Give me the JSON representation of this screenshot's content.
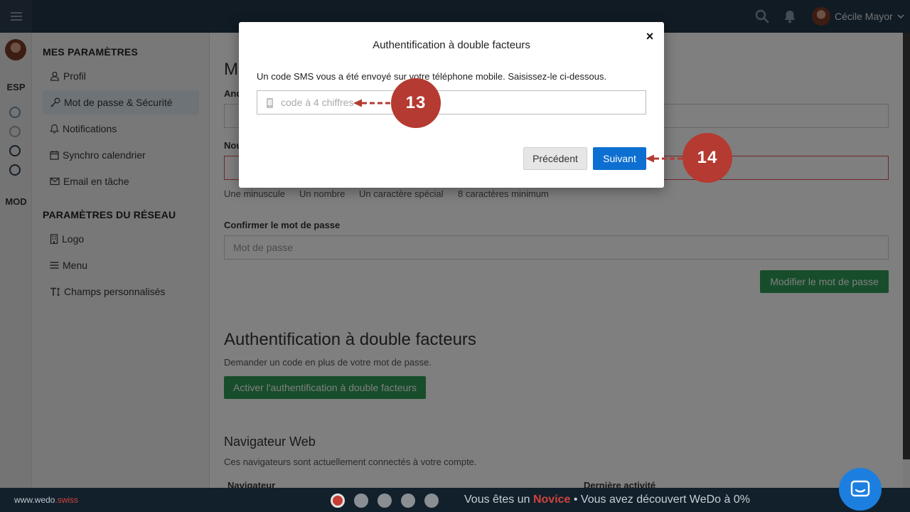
{
  "topbar": {
    "user_name": "Cécile Mayor"
  },
  "rail": {
    "section1": "ESP",
    "section2": "MOD"
  },
  "sidebar": {
    "heading1": "MES PARAMÈTRES",
    "items1": [
      {
        "label": "Profil"
      },
      {
        "label": "Mot de passe & Sécurité"
      },
      {
        "label": "Notifications"
      },
      {
        "label": "Synchro calendrier"
      },
      {
        "label": "Email en tâche"
      }
    ],
    "heading2": "PARAMÈTRES DU RÉSEAU",
    "items2": [
      {
        "label": "Logo"
      },
      {
        "label": "Menu"
      },
      {
        "label": "Champs personnalisés"
      }
    ]
  },
  "main": {
    "title_partial": "M",
    "old_pw_label": "And",
    "new_pw_label": "Nou",
    "rules": [
      "Une minuscule",
      "Un nombre",
      "Un caractère spécial",
      "8 caractères minimum"
    ],
    "confirm_label": "Confirmer le mot de passe",
    "confirm_placeholder": "Mot de passe",
    "change_pw_button": "Modifier le mot de passe",
    "twofa_title": "Authentification à double facteurs",
    "twofa_desc": "Demander un code en plus de votre mot de passe.",
    "twofa_button": "Activer l'authentification à double facteurs",
    "browsers_title": "Navigateur Web",
    "browsers_desc": "Ces navigateurs sont actuellement connectés à votre compte.",
    "col_browser": "Navigateur",
    "col_last_activity": "Dernière activité"
  },
  "modal": {
    "title": "Authentification à double facteurs",
    "close_label": "×",
    "message": "Un code SMS vous a été envoyé sur votre téléphone mobile. Saisissez-le ci-dessous.",
    "code_placeholder": "code à 4 chiffres",
    "code_value": "",
    "prev_button": "Précédent",
    "next_button": "Suivant"
  },
  "annotations": {
    "step_a": "13",
    "step_b": "14"
  },
  "bottombar": {
    "brand_main": "www.wedo",
    "brand_suffix": ".swiss",
    "status_prefix": "Vous êtes un ",
    "status_level": "Novice",
    "status_suffix": " • Vous avez découvert WeDo à 0%"
  },
  "colors": {
    "topbar": "#233747",
    "primary_button": "#0c6fd1",
    "success_button": "#2e9a57",
    "annotation": "#b53a31"
  }
}
